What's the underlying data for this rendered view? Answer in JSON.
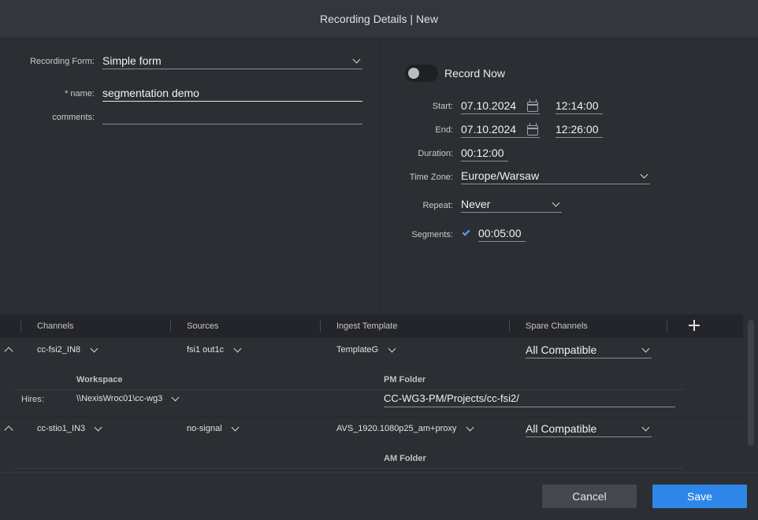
{
  "title": "Recording Details | New",
  "form": {
    "recording_form_label": "Recording Form:",
    "recording_form_value": "Simple form",
    "name_label": "* name:",
    "name_value": "segmentation demo",
    "comments_label": "comments:",
    "comments_value": ""
  },
  "schedule": {
    "record_now_label": "Record Now",
    "record_now_on": false,
    "start_label": "Start:",
    "start_date": "07.10.2024",
    "start_time": "12:14:00",
    "end_label": "End:",
    "end_date": "07.10.2024",
    "end_time": "12:26:00",
    "duration_label": "Duration:",
    "duration_value": "00:12:00",
    "timezone_label": "Time Zone:",
    "timezone_value": "Europe/Warsaw",
    "repeat_label": "Repeat:",
    "repeat_value": "Never",
    "segments_label": "Segments:",
    "segments_checked": true,
    "segments_value": "00:05:00"
  },
  "table": {
    "headers": [
      "Channels",
      "Sources",
      "Ingest Template",
      "Spare Channels"
    ],
    "rows": [
      {
        "channel": "cc-fsi2_IN8",
        "source": "fsi1 out1c",
        "template": "TemplateG",
        "spare": "All Compatible",
        "workspace_label": "Workspace",
        "folder_label": "PM Folder",
        "hires_label": "Hires:",
        "workspace_value": "\\\\NexisWroc01\\cc-wg3",
        "folder_value": "CC-WG3-PM/Projects/cc-fsi2/"
      },
      {
        "channel": "cc-stio1_IN3",
        "source": "no-signal",
        "template": "AVS_1920.1080p25_am+proxy",
        "spare": "All Compatible",
        "folder_label": "AM Folder"
      }
    ]
  },
  "footer": {
    "cancel_label": "Cancel",
    "save_label": "Save"
  },
  "colors": {
    "accent": "#2d86e8",
    "check": "#5aa0ff",
    "background": "#2b2e33"
  },
  "icons": [
    "calendar-icon",
    "chevron-down-icon",
    "chevron-up-icon",
    "plus-icon",
    "checkmark-icon"
  ]
}
